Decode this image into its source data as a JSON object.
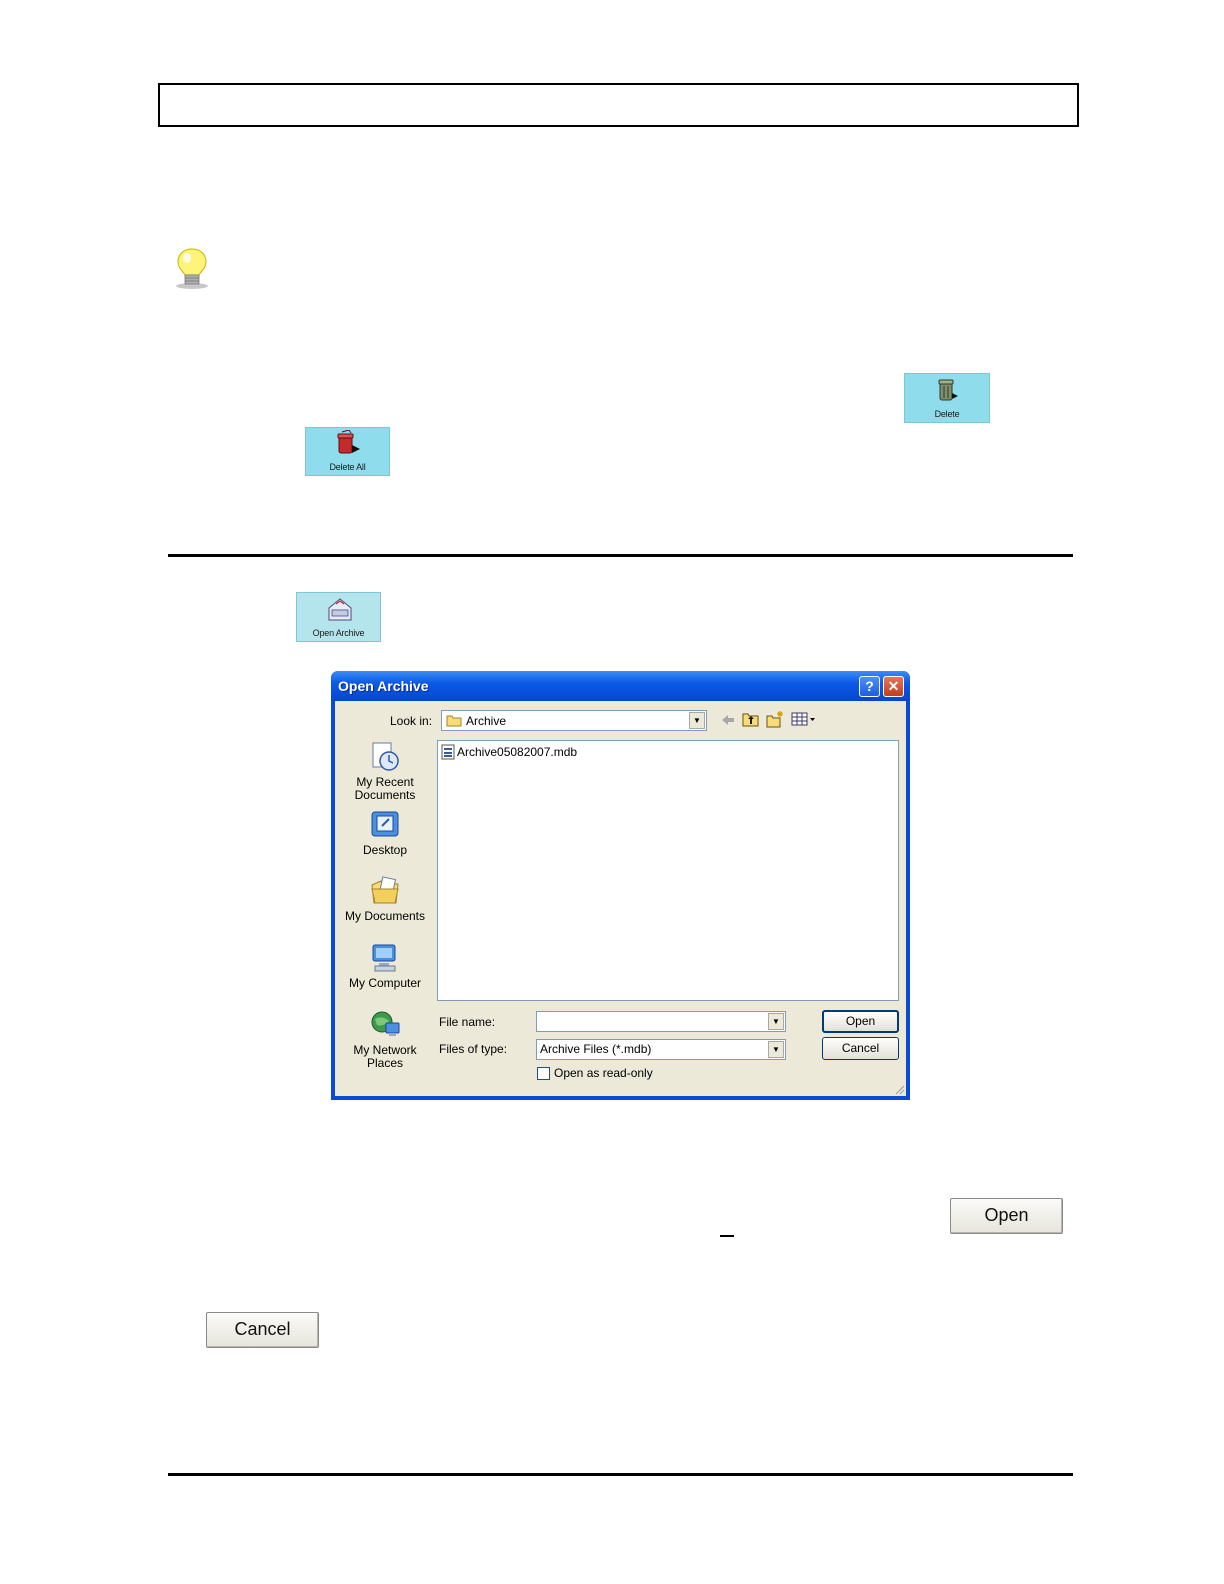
{
  "toolbar_buttons": {
    "delete_label": "Delete",
    "delete_all_label": "Delete All",
    "open_archive_label": "Open Archive"
  },
  "dialog": {
    "title": "Open Archive",
    "help_glyph": "?",
    "close_glyph": "✕",
    "look_in_label": "Look in:",
    "look_in_value": "Archive",
    "places": [
      "My Recent Documents",
      "Desktop",
      "My Documents",
      "My Computer",
      "My Network Places"
    ],
    "files": [
      "Archive05082007.mdb"
    ],
    "file_name_label": "File name:",
    "file_name_value": "",
    "files_of_type_label": "Files of type:",
    "files_of_type_value": "Archive Files (*.mdb)",
    "read_only_label": "Open as read-only",
    "read_only_checked": false,
    "open_button": "Open",
    "cancel_button": "Cancel"
  },
  "standalone_buttons": {
    "open_label": "Open",
    "cancel_label": "Cancel"
  },
  "icons": [
    "lightbulb-icon",
    "trash-can-icon",
    "delete-all-icon",
    "open-archive-icon",
    "folder-icon",
    "mdb-file-icon",
    "back-arrow-icon",
    "up-folder-icon",
    "new-folder-icon",
    "views-menu-icon"
  ],
  "colors": {
    "toolbar_button_bg": "#8fdcec",
    "xp_title_blue": "#0b5ae6",
    "dialog_bg": "#ece9d8"
  }
}
